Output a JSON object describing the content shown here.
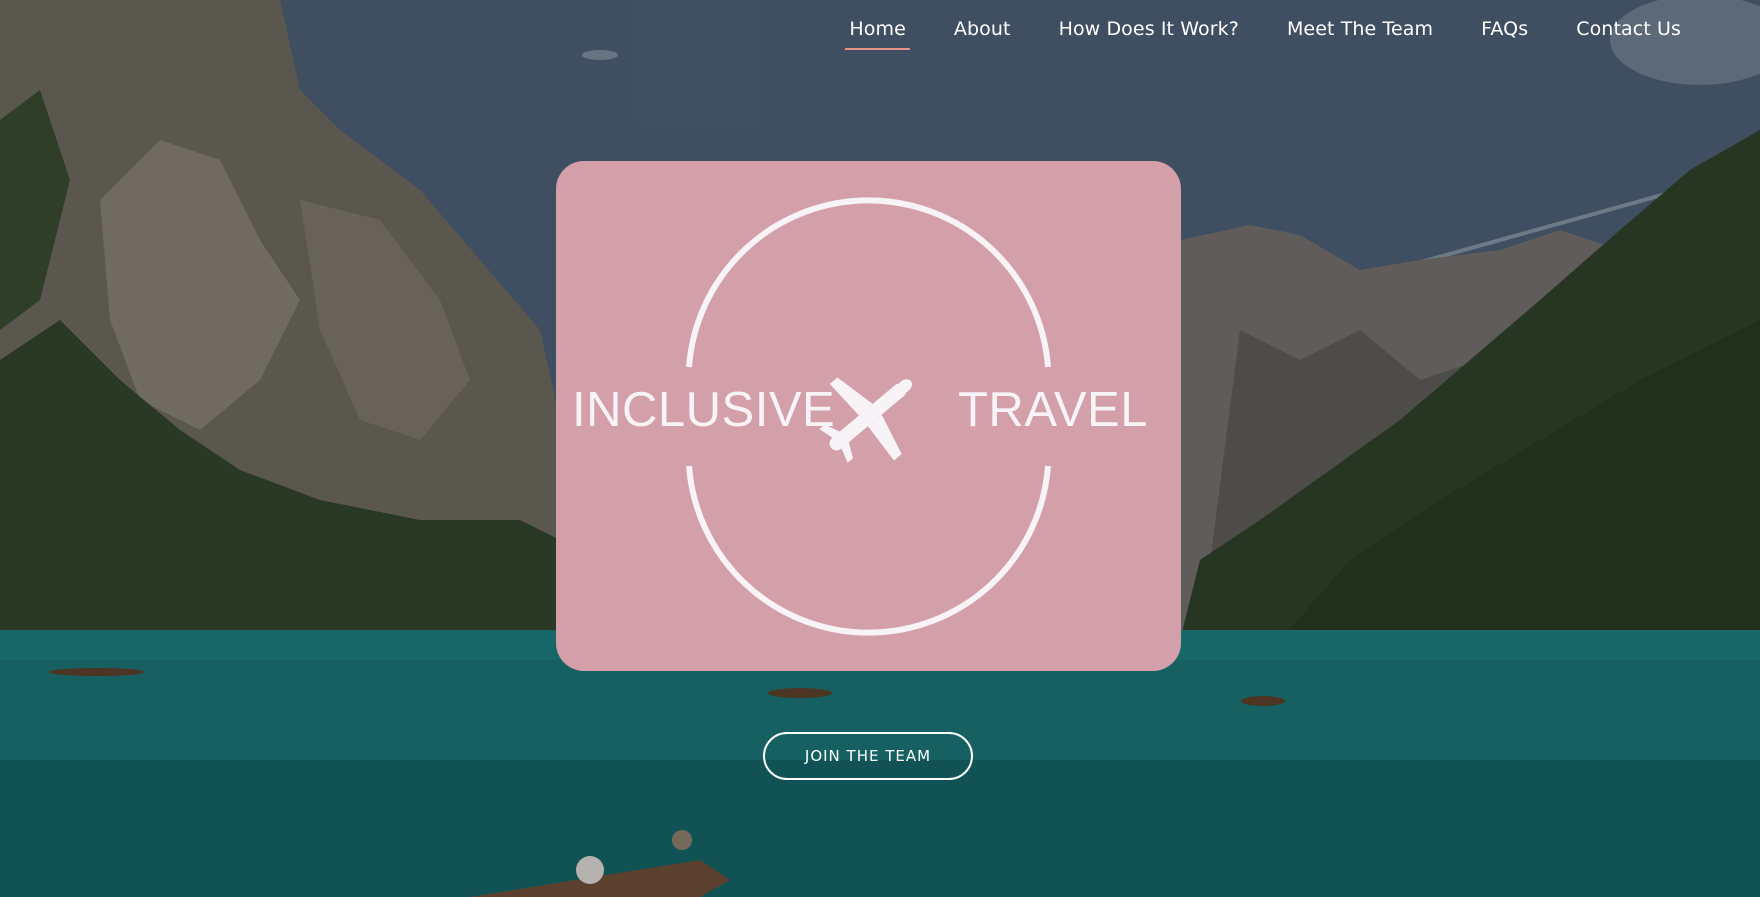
{
  "nav": {
    "items": [
      {
        "label": "Home",
        "active": true
      },
      {
        "label": "About",
        "active": false
      },
      {
        "label": "How Does It Work?",
        "active": false
      },
      {
        "label": "Meet The Team",
        "active": false
      },
      {
        "label": "FAQs",
        "active": false
      },
      {
        "label": "Contact Us",
        "active": false
      }
    ],
    "active_underline_color": "#e88f86"
  },
  "logo": {
    "text_left": "INCLUSIVE",
    "text_right": "TRAVEL",
    "card_color": "#d39fa9",
    "icon": "airplane-icon"
  },
  "cta": {
    "label": "JOIN THE TEAM"
  },
  "background": {
    "description_icon": "mountain-lake-photo"
  }
}
